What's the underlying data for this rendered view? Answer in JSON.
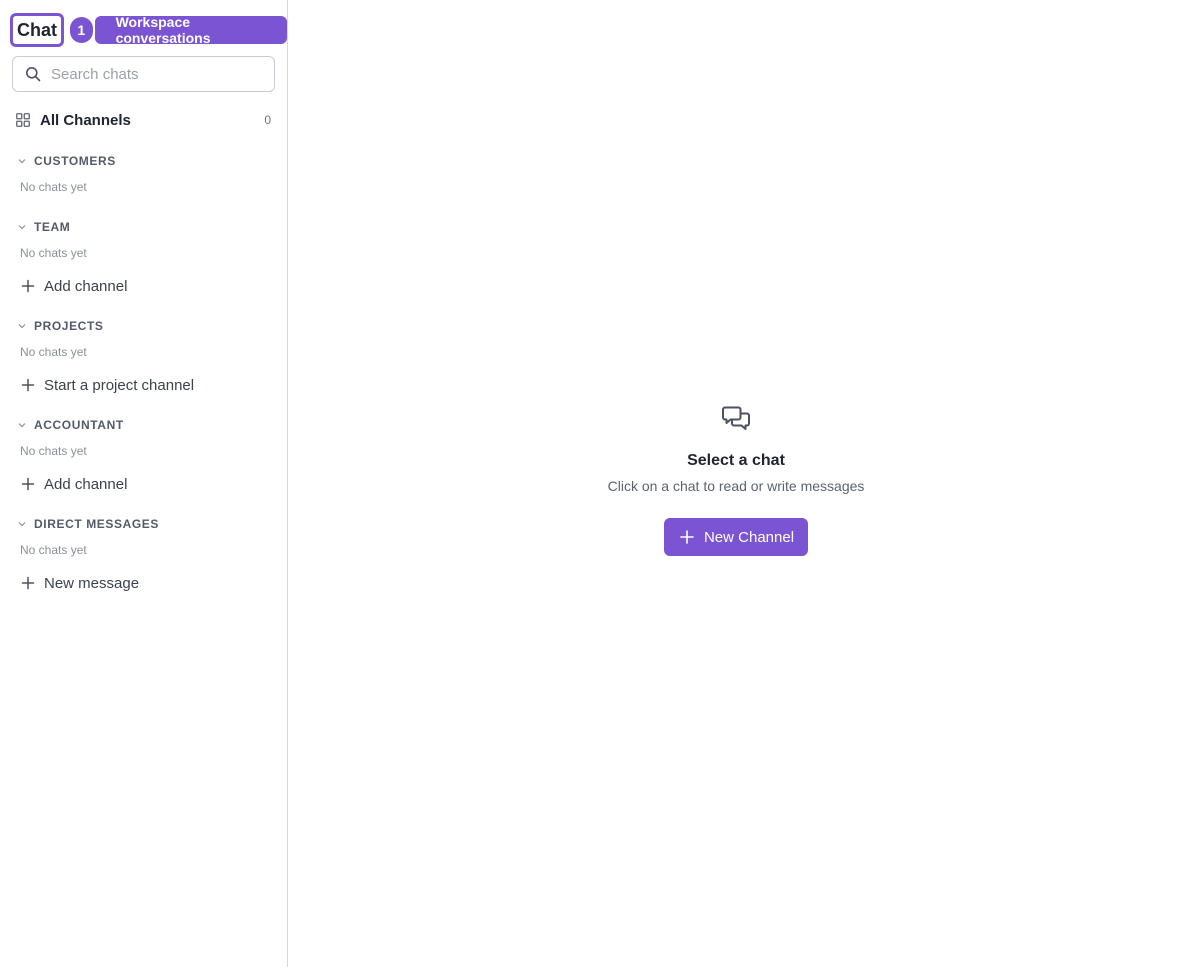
{
  "header": {
    "title": "Chat",
    "badge_count": "1",
    "badge_label": "Workspace conversations"
  },
  "search": {
    "placeholder": "Search chats",
    "value": ""
  },
  "all_channels": {
    "label": "All Channels",
    "count": "0",
    "icon": "grid-icon"
  },
  "sections": [
    {
      "title": "CUSTOMERS",
      "empty": "No chats yet",
      "action": ""
    },
    {
      "title": "TEAM",
      "empty": "No chats yet",
      "action": "Add channel"
    },
    {
      "title": "PROJECTS",
      "empty": "No chats yet",
      "action": "Start a project channel"
    },
    {
      "title": "ACCOUNTANT",
      "empty": "No chats yet",
      "action": "Add channel"
    },
    {
      "title": "DIRECT MESSAGES",
      "empty": "No chats yet",
      "action": "New message"
    }
  ],
  "empty_state": {
    "icon": "chat-bubbles-icon",
    "title": "Select a chat",
    "subtitle": "Click on a chat to read or write messages",
    "button_label": "New Channel"
  },
  "colors": {
    "accent": "#7b54d4",
    "border": "#d9d4ee",
    "muted": "#8a909a"
  }
}
